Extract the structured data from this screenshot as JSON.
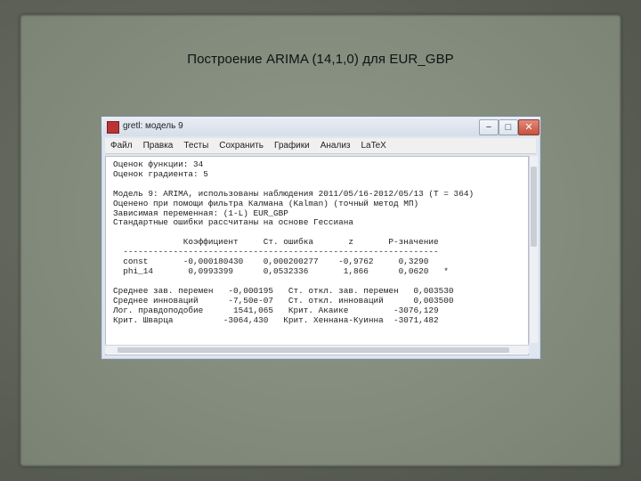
{
  "slide": {
    "title": "Построение ARIMA (14,1,0) для EUR_GBP"
  },
  "window": {
    "title": "gretl: модель 9",
    "controls": {
      "minimize": "−",
      "maximize": "□",
      "close": "✕"
    },
    "menu": [
      "Файл",
      "Правка",
      "Тесты",
      "Сохранить",
      "Графики",
      "Анализ",
      "LaTeX"
    ],
    "output_lines": [
      "Оценок функции: 34",
      "Оценок градиента: 5",
      "",
      "Модель 9: ARIMA, использованы наблюдения 2011/05/16-2012/05/13 (T = 364)",
      "Оценено при помощи фильтра Калмана (Kalman) (точный метод МП)",
      "Зависимая переменная: (1-L) EUR_GBP",
      "Стандартные ошибки рассчитаны на основе Гессиана",
      "",
      "              Коэффициент     Ст. ошибка       z       P-значение",
      "  ---------------------------------------------------------------",
      "  const       -0,000180430    0,000200277    -0,9762     0,3290",
      "  phi_14       0,0993399      0,0532336       1,866      0,0620   *",
      "",
      "Среднее зав. перемен   -0,000195   Ст. откл. зав. перемен   0,003530",
      "Среднее инноваций      -7,50e-07   Ст. откл. инноваций      0,003500",
      "Лог. правдоподобие      1541,065   Крит. Акаике         -3076,129",
      "Крит. Шварца          -3064,430   Крит. Хеннана-Куинна  -3071,482"
    ]
  },
  "colors": {
    "frame": "#5f6358",
    "paper": "#8a9284",
    "window_chrome": "#dfe6ef",
    "close_button": "#c8503c"
  }
}
